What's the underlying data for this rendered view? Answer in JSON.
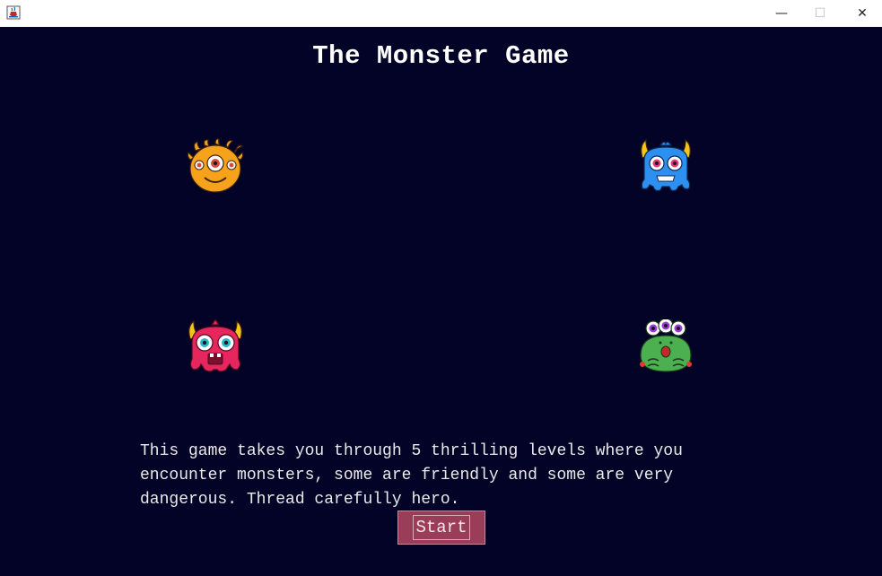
{
  "window": {
    "icon": "java-cup-icon",
    "controls": {
      "minimize": "—",
      "maximize": "☐",
      "close": "✕"
    }
  },
  "game": {
    "title": "The Monster Game",
    "description": "This game takes you through 5 thrilling levels where you\nencounter monsters, some are friendly and some are very\ndangerous. Thread carefully hero.",
    "start_label": "Start"
  },
  "monsters": [
    {
      "name": "orange-cyclops-monster-icon",
      "color": "#f7a21b"
    },
    {
      "name": "blue-horned-monster-icon",
      "color": "#2d8ff0"
    },
    {
      "name": "pink-horned-monster-icon",
      "color": "#e8265e"
    },
    {
      "name": "green-three-eyed-monster-icon",
      "color": "#4caf50"
    }
  ],
  "colors": {
    "background": "#020326",
    "button": "#9a3d59",
    "text": "#eaeaea"
  }
}
